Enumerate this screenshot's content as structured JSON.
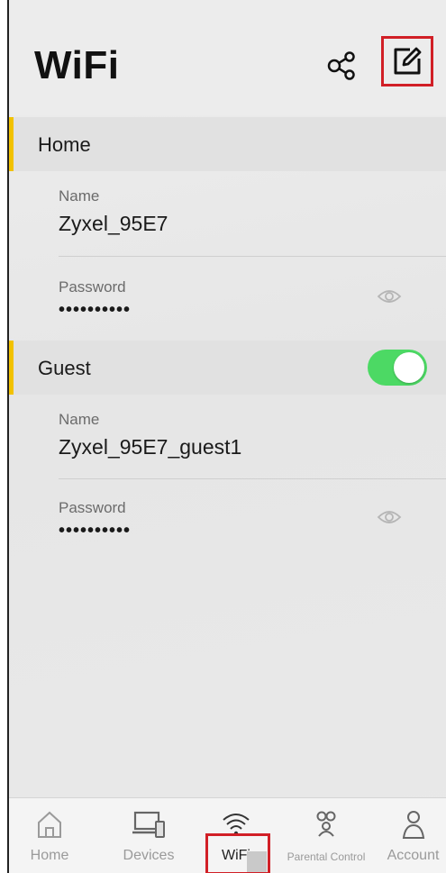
{
  "header": {
    "title": "WiFi",
    "share_icon": "share-icon",
    "edit_icon": "edit-icon"
  },
  "home": {
    "section_label": "Home",
    "name_label": "Name",
    "name_value": "Zyxel_95E7",
    "password_label": "Password",
    "password_value": "••••••••••"
  },
  "guest": {
    "section_label": "Guest",
    "enabled": true,
    "name_label": "Name",
    "name_value": "Zyxel_95E7_guest1",
    "password_label": "Password",
    "password_value": "••••••••••"
  },
  "tabbar": {
    "items": [
      {
        "label": "Home",
        "icon": "home-icon"
      },
      {
        "label": "Devices",
        "icon": "devices-icon"
      },
      {
        "label": "WiFi",
        "icon": "wifi-icon",
        "active": true
      },
      {
        "label": "Parental Control",
        "icon": "parental-control-icon"
      },
      {
        "label": "Account",
        "icon": "account-icon"
      }
    ]
  },
  "colors": {
    "accent_bar": "#f2c200",
    "toggle_on": "#4cd964",
    "annotation_red": "#d11f26"
  }
}
